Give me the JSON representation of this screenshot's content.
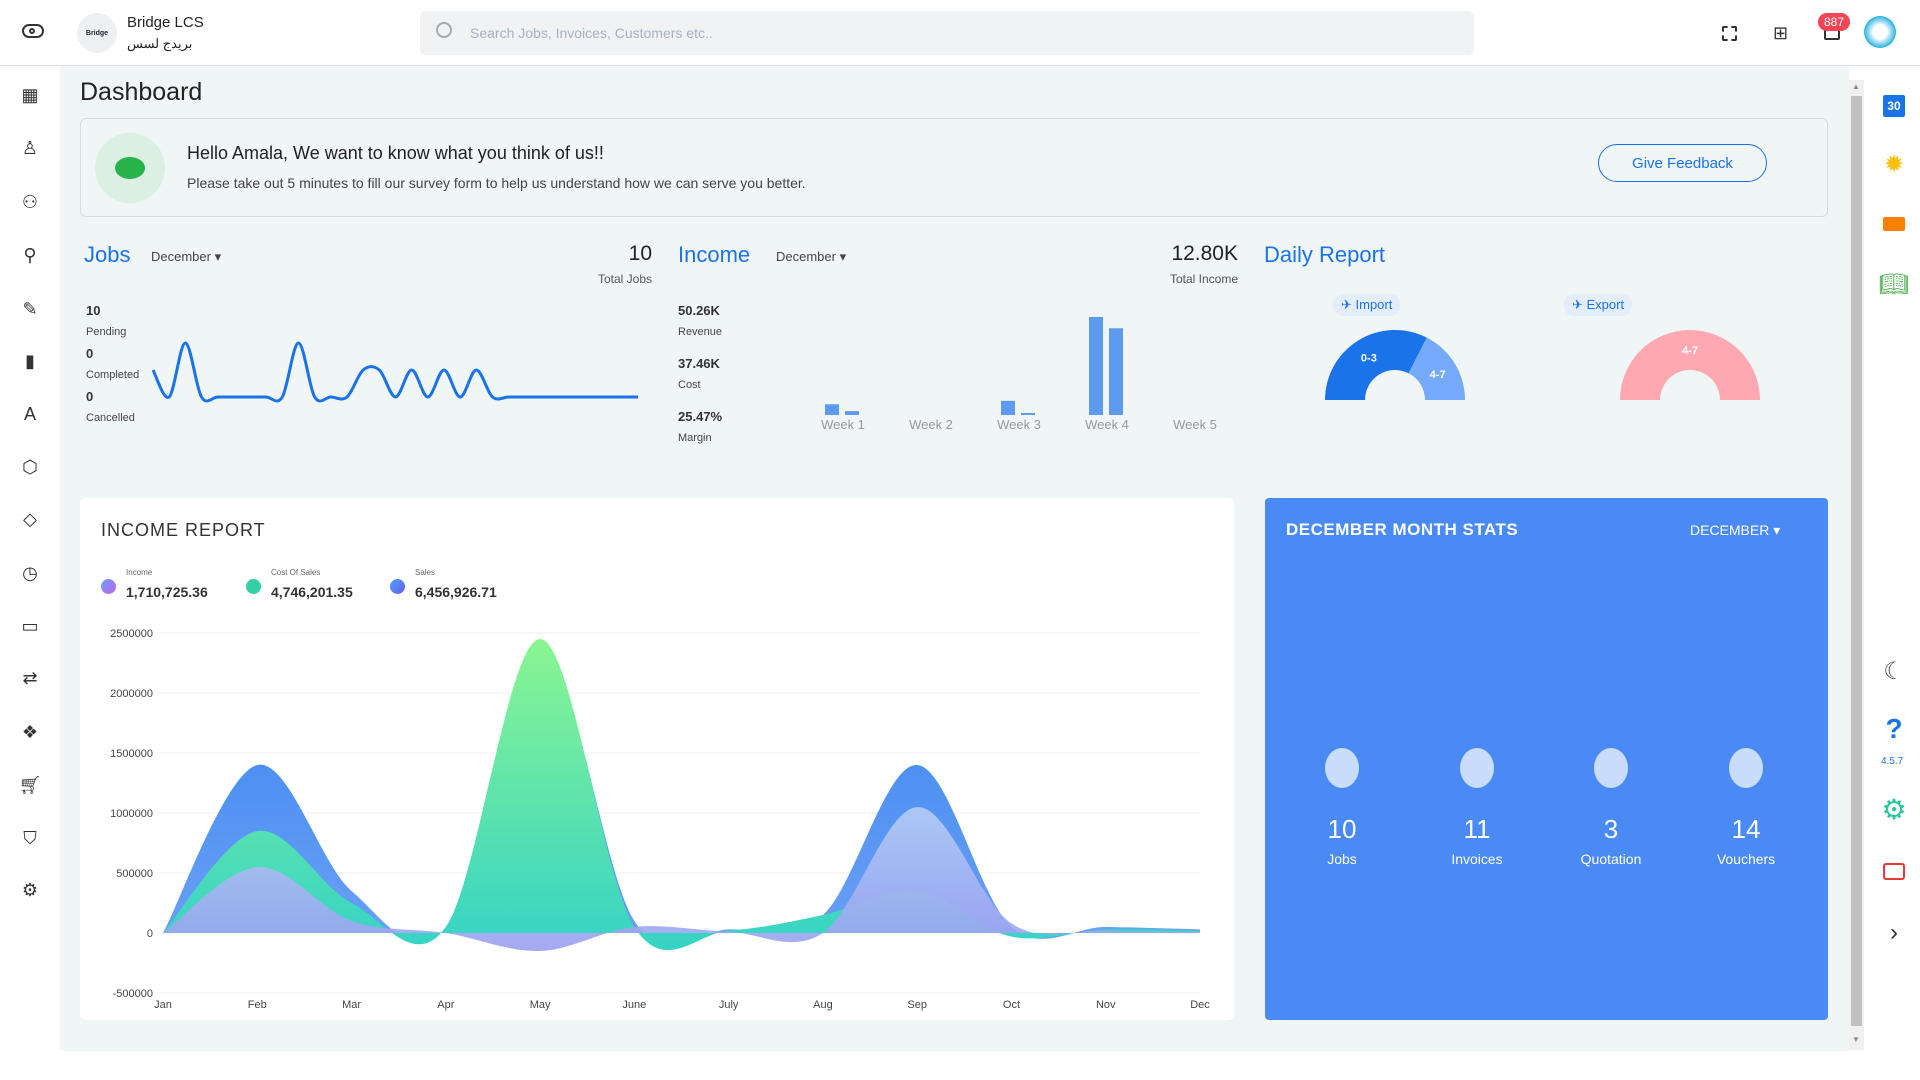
{
  "header": {
    "company": "Bridge LCS",
    "company_ar": "بريدج لسس",
    "logo_text": "Bridge",
    "search_placeholder": "Search Jobs, Invoices, Customers etc..",
    "notification_count": "887"
  },
  "sidebar": {
    "items": [
      "dashboard",
      "user",
      "users",
      "add-user",
      "edit",
      "bar-chart",
      "triangle-a",
      "box",
      "tag",
      "clock",
      "credit-card",
      "repeat",
      "network",
      "cart",
      "shield",
      "gear"
    ]
  },
  "page": {
    "title": "Dashboard"
  },
  "feedback": {
    "title": "Hello Amala, We want to know what you think of us!!",
    "text": "Please take out 5 minutes to fill our survey form to help us understand how we can serve you better.",
    "button": "Give Feedback"
  },
  "jobs": {
    "title": "Jobs",
    "month": "December",
    "total": "10",
    "total_label": "Total Jobs",
    "stats": [
      {
        "value": "10",
        "label": "Pending"
      },
      {
        "value": "0",
        "label": "Completed"
      },
      {
        "value": "0",
        "label": "Cancelled"
      }
    ],
    "daily": [
      1,
      0,
      2,
      0,
      0,
      0,
      0,
      0,
      0,
      2,
      0,
      0,
      0,
      1,
      1,
      0,
      1,
      0,
      1,
      0,
      1,
      0,
      0,
      0,
      0,
      0,
      0,
      0,
      0,
      0,
      0
    ]
  },
  "income": {
    "title": "Income",
    "month": "December",
    "total": "12.80K",
    "total_label": "Total Income",
    "stats": [
      {
        "value": "50.26K",
        "label": "Revenue"
      },
      {
        "value": "37.46K",
        "label": "Cost"
      },
      {
        "value": "25.47%",
        "label": "Margin"
      }
    ],
    "weeks": [
      "Week 1",
      "Week 2",
      "Week 3",
      "Week 4",
      "Week 5"
    ],
    "revenue_k": [
      4.4,
      0,
      5.8,
      40.06,
      0
    ],
    "cost_k": [
      1.6,
      0,
      0.4,
      35.46,
      0
    ]
  },
  "daily_report": {
    "title": "Daily Report",
    "import_label": "Import",
    "export_label": "Export",
    "import": [
      {
        "label": "0-3",
        "share": 0.65,
        "color": "#1a73e8"
      },
      {
        "label": "4-7",
        "share": 0.35,
        "color": "#74aaf9"
      }
    ],
    "export": [
      {
        "label": "4-7",
        "share": 1.0,
        "color": "#fea8b2"
      }
    ]
  },
  "chart_data": {
    "type": "area",
    "title": "INCOME REPORT",
    "categories": [
      "Jan",
      "Feb",
      "Mar",
      "Apr",
      "May",
      "June",
      "July",
      "Aug",
      "Sep",
      "Oct",
      "Nov",
      "Dec"
    ],
    "ylim": [
      -500000,
      2500000
    ],
    "yticks": [
      "2500000",
      "2000000",
      "1500000",
      "1000000",
      "500000",
      "0",
      "-500000"
    ],
    "grid": true,
    "series": [
      {
        "name": "Sales",
        "total": "6,456,926.71",
        "color": "#4f8df5",
        "values": [
          0,
          1400000,
          350000,
          50000,
          2400000,
          100000,
          30000,
          150000,
          1400000,
          50000,
          50000,
          30000
        ]
      },
      {
        "name": "Cost Of Sales",
        "total": "4,746,201.35",
        "color": "#3dd6b0",
        "values": [
          0,
          850000,
          250000,
          50000,
          2450000,
          50000,
          20000,
          150000,
          350000,
          -30000,
          30000,
          20000
        ]
      },
      {
        "name": "Income",
        "total": "1,710,725.36",
        "color": "#a78bfa",
        "values": [
          0,
          550000,
          100000,
          0,
          -150000,
          50000,
          10000,
          0,
          1050000,
          80000,
          20000,
          10000
        ]
      }
    ]
  },
  "stats": {
    "title": "DECEMBER MONTH STATS",
    "month": "DECEMBER",
    "items": [
      {
        "value": "10",
        "label": "Jobs"
      },
      {
        "value": "11",
        "label": "Invoices"
      },
      {
        "value": "3",
        "label": "Quotation"
      },
      {
        "value": "14",
        "label": "Vouchers"
      }
    ],
    "color": "#4a8af4"
  },
  "rail": {
    "calendar_day": "30",
    "version": "4.5.7"
  }
}
